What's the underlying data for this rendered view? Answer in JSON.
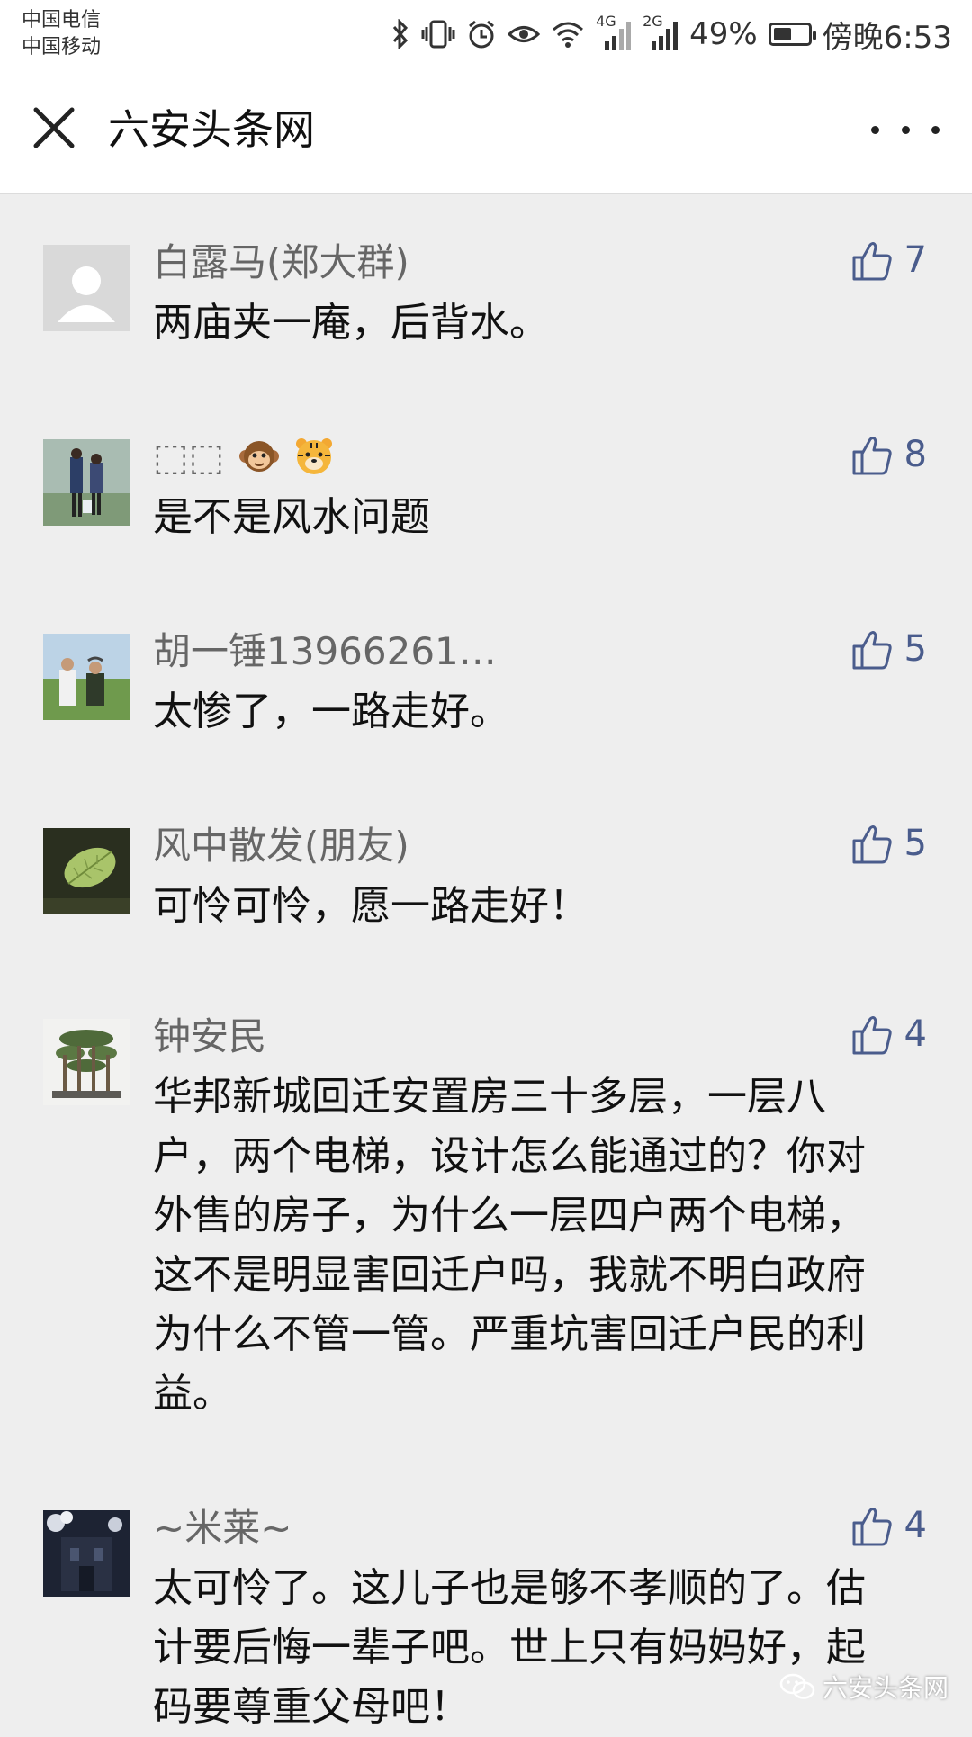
{
  "status_bar": {
    "carrier_1": "中国电信",
    "carrier_2": "中国移动",
    "network_1": "4G",
    "network_2": "2G",
    "battery": "49%",
    "time": "傍晚6:53"
  },
  "header": {
    "title": "六安头条网",
    "close_icon": "close-icon",
    "more_icon": "more-icon"
  },
  "comments": [
    {
      "nickname": "白露马(郑大群)",
      "text": "两庙夹一庵，后背水。",
      "likes": "7",
      "avatar": "default-avatar"
    },
    {
      "nickname": "⬚⬚",
      "text": "是不是风水问题",
      "likes": "8",
      "avatar": "couple-walking-photo"
    },
    {
      "nickname": "胡一锤13966261…",
      "text": "太惨了，一路走好。",
      "likes": "5",
      "avatar": "two-people-field-photo"
    },
    {
      "nickname": "风中散发(朋友)",
      "text": "可怜可怜，愿一路走好！",
      "likes": "5",
      "avatar": "leaf-photo"
    },
    {
      "nickname": "钟安民",
      "text": "华邦新城回迁安置房三十多层，一层八户，两个电梯，设计怎么能通过的？你对外售的房子，为什么一层四户两个电梯，这不是明显害回迁户吗，我就不明白政府为什么不管一管。严重坑害回迁户民的利益。",
      "likes": "4",
      "avatar": "bonsai-photo"
    },
    {
      "nickname": "~米莱~",
      "text": "太可怜了。这儿子也是够不孝顺的了。估计要后悔一辈子吧。世上只有妈妈好，起码要尊重父母吧！",
      "likes": "4",
      "avatar": "night-building-photo"
    }
  ],
  "watermark": "六安头条网",
  "colors": {
    "like": "#4a5c8c",
    "background": "#eeeeee",
    "nickname": "#666666"
  }
}
